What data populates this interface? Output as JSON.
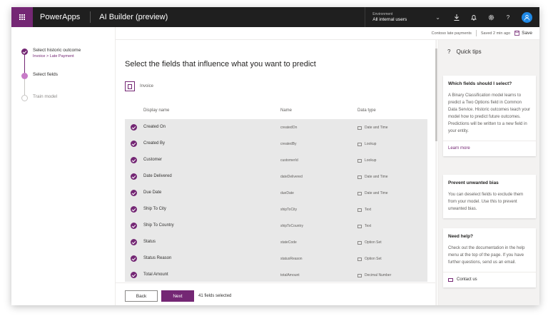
{
  "topbar": {
    "app_name": "PowerApps",
    "product": "AI Builder (preview)",
    "environment_label": "Environment",
    "environment_value": "All internal users"
  },
  "subbar": {
    "model_name": "Contoso late payments",
    "saved": "Saved 2 min ago",
    "save_label": "Save"
  },
  "steps": [
    {
      "title": "Select historic outcome",
      "subtitle": "Invoice > Late Payment",
      "state": "done"
    },
    {
      "title": "Select fields",
      "subtitle": "",
      "state": "current"
    },
    {
      "title": "Train model",
      "subtitle": "",
      "state": "todo"
    }
  ],
  "main": {
    "heading": "Select the fields that influence what you want to predict",
    "entity": "Invoice",
    "columns": {
      "display": "Display name",
      "name": "Name",
      "type": "Data type"
    },
    "rows": [
      {
        "display": "Created On",
        "name": "createdOn",
        "type": "Date and Time"
      },
      {
        "display": "Created By",
        "name": "createdBy",
        "type": "Lookup"
      },
      {
        "display": "Customer",
        "name": "customerId",
        "type": "Lookup"
      },
      {
        "display": "Date Delivered",
        "name": "dateDelivered",
        "type": "Date and Time"
      },
      {
        "display": "Due Date",
        "name": "dueDate",
        "type": "Date and Time"
      },
      {
        "display": "Ship To City",
        "name": "shipToCity",
        "type": "Text"
      },
      {
        "display": "Ship To Country",
        "name": "shipToCountry",
        "type": "Text"
      },
      {
        "display": "Status",
        "name": "stateCode",
        "type": "Option Set"
      },
      {
        "display": "Status Reason",
        "name": "statusReason",
        "type": "Option Set"
      },
      {
        "display": "Total Amount",
        "name": "totalAmount",
        "type": "Decimal Number"
      }
    ],
    "back_label": "Back",
    "next_label": "Next",
    "selected_count": "41 fields selected"
  },
  "tips": {
    "title": "Quick tips",
    "cards": [
      {
        "title": "Which fields should I select?",
        "body": "A Binary Classification model learns to predict a Two Options field in Common Data Service. Historic outcomes teach your model how to predict future outcomes. Predictions will be written to a new field in your entity.",
        "link": "Learn more"
      },
      {
        "title": "Prevent unwanted bias",
        "body": "You can deselect fields to exclude them from your model. Use this to prevent unwanted bias."
      },
      {
        "title": "Need help?",
        "body": "Check out the documentation in the help menu at the top of the page. If you have further questions, send us an email.",
        "link": "Contact us"
      }
    ]
  },
  "colors": {
    "accent": "#742774",
    "topbar": "#1f1f1f",
    "avatar": "#1e88e5"
  }
}
